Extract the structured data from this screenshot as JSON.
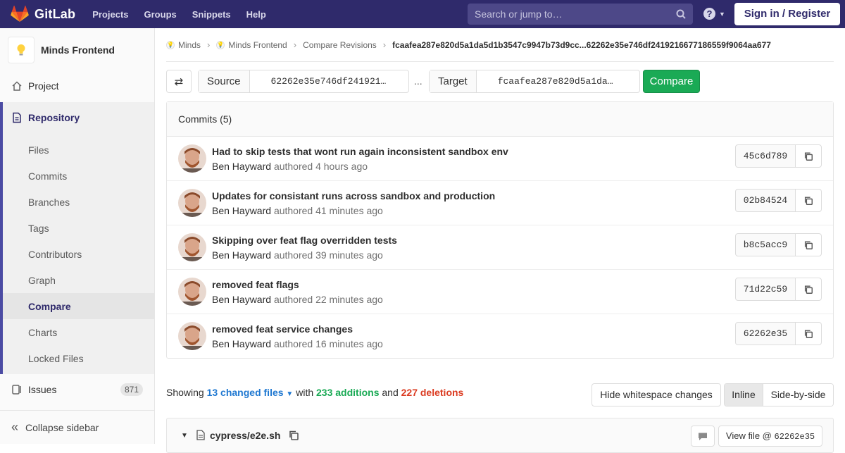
{
  "navbar": {
    "brand": "GitLab",
    "links": [
      "Projects",
      "Groups",
      "Snippets",
      "Help"
    ],
    "search_placeholder": "Search or jump to…",
    "signin": "Sign in / Register"
  },
  "sidebar": {
    "project_name": "Minds Frontend",
    "project": "Project",
    "repository": "Repository",
    "repo_items": [
      "Files",
      "Commits",
      "Branches",
      "Tags",
      "Contributors",
      "Graph",
      "Compare",
      "Charts",
      "Locked Files"
    ],
    "active_item": "Compare",
    "issues": "Issues",
    "issues_count": "871",
    "collapse": "Collapse sidebar"
  },
  "breadcrumbs": [
    "Minds",
    "Minds Frontend",
    "Compare Revisions",
    "fcaafea287e820d5a1da5d1b3547c9947b73d9cc...62262e35e746df2419216677186559f9064aa677"
  ],
  "compare": {
    "source_label": "Source",
    "source_value": "62262e35e746df241921…",
    "dots": "...",
    "target_label": "Target",
    "target_value": "fcaafea287e820d5a1da…",
    "button": "Compare"
  },
  "commits": {
    "header": "Commits (5)",
    "items": [
      {
        "title": "Had to skip tests that wont run again inconsistent sandbox env",
        "author": "Ben Hayward",
        "time": "authored 4 hours ago",
        "sha": "45c6d789"
      },
      {
        "title": "Updates for consistant runs across sandbox and production",
        "author": "Ben Hayward",
        "time": "authored 41 minutes ago",
        "sha": "02b84524"
      },
      {
        "title": "Skipping over feat flag overridden tests",
        "author": "Ben Hayward",
        "time": "authored 39 minutes ago",
        "sha": "b8c5acc9"
      },
      {
        "title": "removed feat flags",
        "author": "Ben Hayward",
        "time": "authored 22 minutes ago",
        "sha": "71d22c59"
      },
      {
        "title": "removed feat service changes",
        "author": "Ben Hayward",
        "time": "authored 16 minutes ago",
        "sha": "62262e35"
      }
    ]
  },
  "stats": {
    "showing": "Showing",
    "files": "13 changed files",
    "with": "with",
    "additions": "233 additions",
    "and": "and",
    "deletions": "227 deletions"
  },
  "diff_controls": {
    "whitespace": "Hide whitespace changes",
    "inline": "Inline",
    "side_by_side": "Side-by-side"
  },
  "file": {
    "name": "cypress/e2e.sh",
    "view_label": "View file @",
    "view_sha": "62262e35"
  },
  "colors": {
    "navbar": "#2f2a6b",
    "accent": "#4b4ba3",
    "green": "#1aaa55",
    "red": "#db3b21",
    "link": "#1f78d1"
  }
}
